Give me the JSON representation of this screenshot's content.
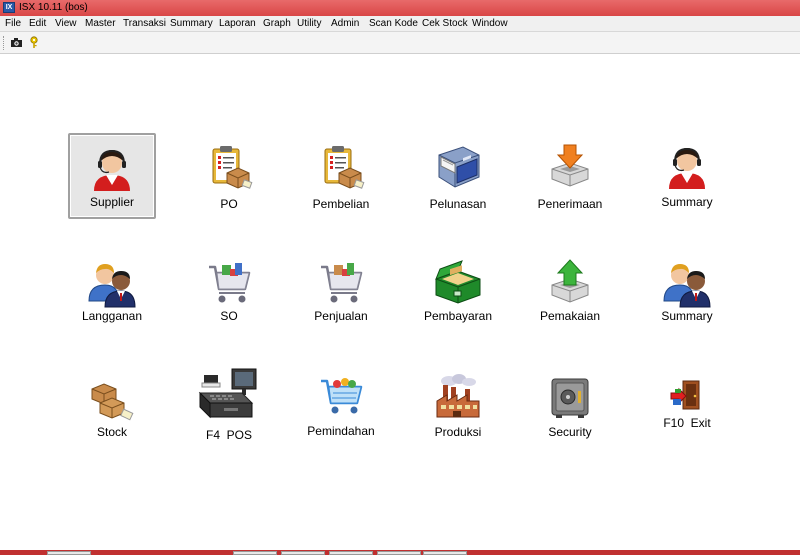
{
  "window": {
    "title": "ISX 10.11 (bos)",
    "app_icon": "isx-app-icon"
  },
  "menu": [
    "File",
    "Edit",
    "View",
    "Master",
    "Transaksi",
    "Summary",
    "Laporan",
    "Graph",
    "Utility",
    "Admin",
    "Scan Kode",
    "Cek Stock",
    "Window"
  ],
  "toolbar": {
    "buttons": [
      "camera-icon",
      "key-icon"
    ]
  },
  "tiles": {
    "supplier": {
      "label": "Supplier",
      "icon": "user-headset-icon",
      "selected": true
    },
    "po": {
      "label": "PO",
      "icon": "clipboard-box-icon"
    },
    "pembelian": {
      "label": "Pembelian",
      "icon": "clipboard-box-icon"
    },
    "pelunasan": {
      "label": "Pelunasan",
      "icon": "drawer-icon"
    },
    "penerimaan": {
      "label": "Penerimaan",
      "icon": "inbox-down-arrow-icon"
    },
    "summary1": {
      "label": "Summary",
      "icon": "user-headset-icon"
    },
    "langganan": {
      "label": "Langganan",
      "icon": "users-icon"
    },
    "so": {
      "label": "SO",
      "icon": "shopping-cart-icon"
    },
    "penjualan": {
      "label": "Penjualan",
      "icon": "shopping-cart-icon"
    },
    "pembayaran": {
      "label": "Pembayaran",
      "icon": "cash-box-icon"
    },
    "pemakaian": {
      "label": "Pemakaian",
      "icon": "inbox-up-arrow-icon"
    },
    "summary2": {
      "label": "Summary",
      "icon": "users-icon"
    },
    "stock": {
      "label": "Stock",
      "icon": "boxes-icon"
    },
    "pos": {
      "label": "F4  POS",
      "icon": "cash-register-icon"
    },
    "pemindahan": {
      "label": "Pemindahan",
      "icon": "basket-icon"
    },
    "produksi": {
      "label": "Produksi",
      "icon": "factory-icon"
    },
    "security": {
      "label": "Security",
      "icon": "safe-icon"
    },
    "exit": {
      "label": "F10  Exit",
      "icon": "exit-door-icon"
    }
  }
}
